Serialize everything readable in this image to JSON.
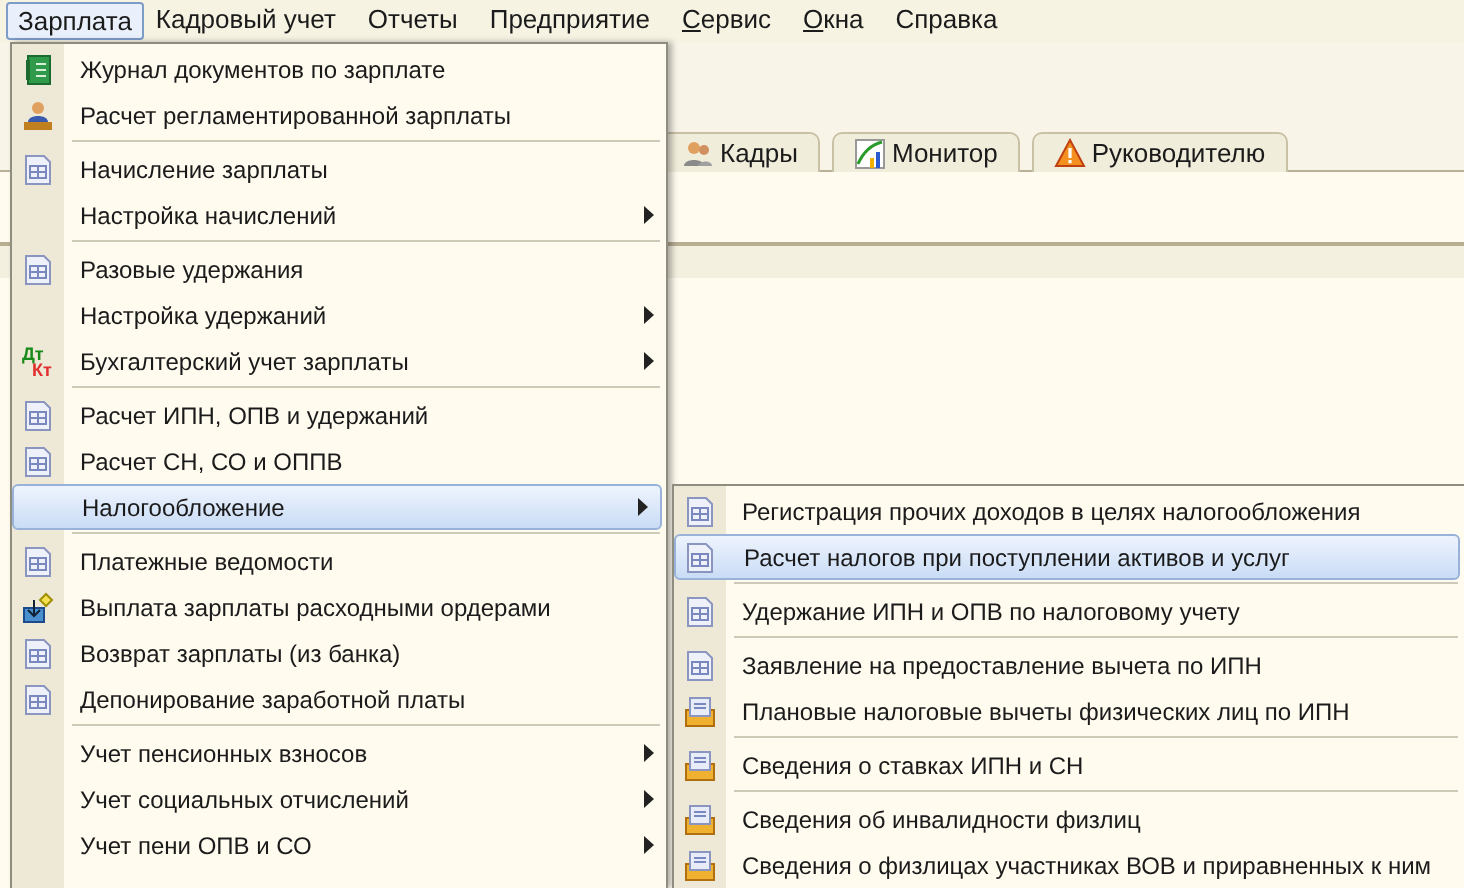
{
  "menubar": [
    {
      "label": "Зарплата",
      "selected": true,
      "underline_first": false
    },
    {
      "label": "Кадровый учет",
      "selected": false,
      "underline_first": false
    },
    {
      "label": "Отчеты",
      "selected": false,
      "underline_first": false
    },
    {
      "label": "Предприятие",
      "selected": false,
      "underline_first": false
    },
    {
      "label": "Сервис",
      "selected": false,
      "underline_first": true
    },
    {
      "label": "Окна",
      "selected": false,
      "underline_first": true
    },
    {
      "label": "Справка",
      "selected": false,
      "underline_first": false
    }
  ],
  "tabs": [
    {
      "label": "Кадры"
    },
    {
      "label": "Монитор"
    },
    {
      "label": "Руководителю"
    }
  ],
  "menu": {
    "items": [
      {
        "kind": "journal",
        "label": "Журнал документов по зарплате",
        "submenu": false,
        "selected": false
      },
      {
        "kind": "person",
        "label": "Расчет регламентированной зарплаты",
        "submenu": false,
        "selected": false
      },
      {
        "kind": "separator"
      },
      {
        "kind": "document",
        "label": "Начисление зарплаты",
        "submenu": false,
        "selected": false
      },
      {
        "kind": "plain",
        "label": "Настройка начислений",
        "submenu": true,
        "selected": false
      },
      {
        "kind": "separator"
      },
      {
        "kind": "document",
        "label": "Разовые удержания",
        "submenu": false,
        "selected": false
      },
      {
        "kind": "plain",
        "label": "Настройка удержаний",
        "submenu": true,
        "selected": false
      },
      {
        "kind": "debit-credit",
        "label": "Бухгалтерский учет зарплаты",
        "icon_text": [
          "Дт",
          "Кт"
        ],
        "submenu": true,
        "selected": false
      },
      {
        "kind": "separator"
      },
      {
        "kind": "document",
        "label": "Расчет ИПН, ОПВ и удержаний",
        "submenu": false,
        "selected": false
      },
      {
        "kind": "document",
        "label": "Расчет СН, СО и ОППВ",
        "submenu": false,
        "selected": false
      },
      {
        "kind": "plain",
        "label": "Налогообложение",
        "submenu": true,
        "selected": true
      },
      {
        "kind": "separator"
      },
      {
        "kind": "document",
        "label": "Платежные ведомости",
        "submenu": false,
        "selected": false
      },
      {
        "kind": "payout",
        "label": "Выплата зарплаты расходными ордерами",
        "submenu": false,
        "selected": false
      },
      {
        "kind": "document",
        "label": "Возврат зарплаты (из банка)",
        "submenu": false,
        "selected": false
      },
      {
        "kind": "document",
        "label": "Депонирование заработной платы",
        "submenu": false,
        "selected": false
      },
      {
        "kind": "separator"
      },
      {
        "kind": "plain",
        "label": "Учет пенсионных взносов",
        "submenu": true,
        "selected": false
      },
      {
        "kind": "plain",
        "label": "Учет социальных отчислений",
        "submenu": true,
        "selected": false
      },
      {
        "kind": "plain",
        "label": "Учет пени ОПВ и СО",
        "submenu": true,
        "selected": false
      }
    ]
  },
  "submenu": {
    "items": [
      {
        "kind": "document",
        "label": "Регистрация прочих доходов в целях налогообложения",
        "selected": false
      },
      {
        "kind": "document",
        "label": "Расчет налогов при поступлении активов и услуг",
        "selected": true
      },
      {
        "kind": "separator"
      },
      {
        "kind": "document",
        "label": "Удержание ИПН и ОПВ по налоговому учету",
        "selected": false
      },
      {
        "kind": "separator"
      },
      {
        "kind": "document",
        "label": "Заявление на предоставление вычета по ИПН",
        "selected": false
      },
      {
        "kind": "register",
        "label": "Плановые налоговые вычеты физических лиц по ИПН",
        "selected": false
      },
      {
        "kind": "separator"
      },
      {
        "kind": "register",
        "label": "Сведения о ставках ИПН и СН",
        "selected": false
      },
      {
        "kind": "separator"
      },
      {
        "kind": "register",
        "label": "Сведения об инвалидности физлиц",
        "selected": false
      },
      {
        "kind": "register",
        "label": "Сведения о физлицах участниках ВОВ и приравненных к ним",
        "selected": false
      }
    ]
  }
}
